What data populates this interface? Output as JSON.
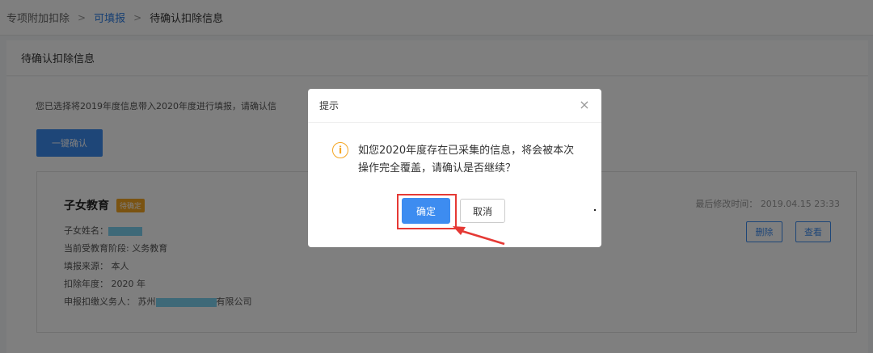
{
  "breadcrumb": {
    "items": [
      {
        "label": "专项附加扣除",
        "type": "plain"
      },
      {
        "label": "可填报",
        "type": "link"
      },
      {
        "label": "待确认扣除信息",
        "type": "current"
      }
    ],
    "separator": ">"
  },
  "section": {
    "title": "待确认扣除信息"
  },
  "notice": "您已选择将2019年度信息带入2020年度进行填报，请确认信",
  "confirm_all_button": "一键确认",
  "card": {
    "title": "子女教育",
    "badge": "待确定",
    "last_modified_label": "最后修改时间：",
    "last_modified_value": "2019.04.15 23:33",
    "fields": {
      "child_name_label": "子女姓名：",
      "stage": "当前受教育阶段: 义务教育",
      "source": "填报来源： 本人",
      "year": "扣除年度： 2020 年",
      "withholding_prefix": "申报扣缴义务人： 苏州",
      "withholding_suffix": "有限公司"
    },
    "delete_button": "删除",
    "view_button": "查看"
  },
  "modal": {
    "title": "提示",
    "close_glyph": "×",
    "info_glyph": "i",
    "message": "如您2020年度存在已采集的信息，将会被本次操作完全覆盖，请确认是否继续？",
    "confirm_label": "确定",
    "cancel_label": "取消"
  },
  "colors": {
    "primary": "#3d8cf0",
    "warning": "#f5a623",
    "annotation": "#e53935",
    "mask": "#7dd3f0"
  }
}
